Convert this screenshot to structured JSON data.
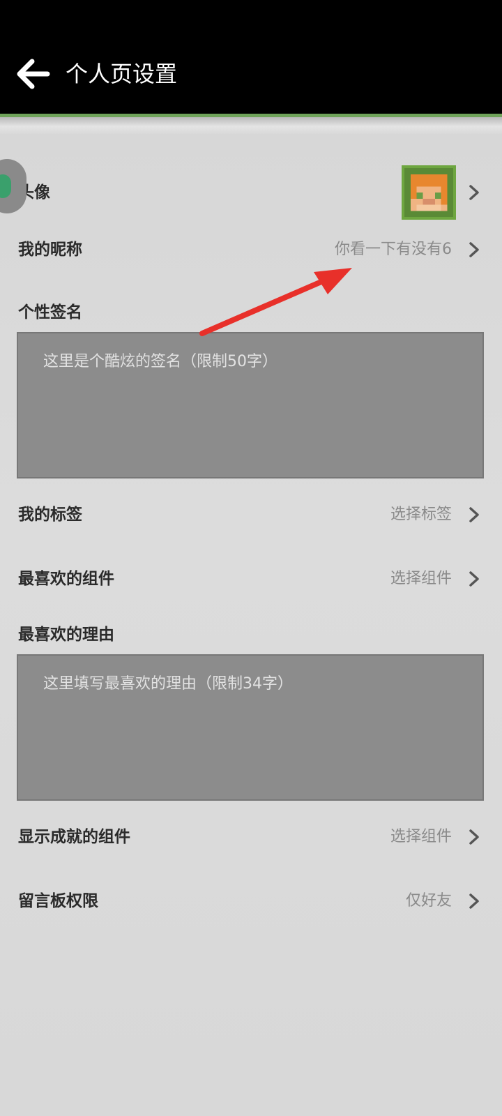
{
  "header": {
    "title": "个人页设置",
    "back_icon": "back-arrow-icon"
  },
  "rows": {
    "avatar": {
      "label": "头像"
    },
    "nickname": {
      "label": "我的昵称",
      "value": "你看一下有没有6"
    },
    "signature": {
      "label": "个性签名",
      "placeholder": "这里是个酷炫的签名（限制50字）"
    },
    "tags": {
      "label": "我的标签",
      "value": "选择标签"
    },
    "favorite_component": {
      "label": "最喜欢的组件",
      "value": "选择组件"
    },
    "favorite_reason": {
      "label": "最喜欢的理由",
      "placeholder": "这里填写最喜欢的理由（限制34字）"
    },
    "achievement_component": {
      "label": "显示成就的组件",
      "value": "选择组件"
    },
    "message_board": {
      "label": "留言板权限",
      "value": "仅好友"
    }
  },
  "colors": {
    "header_bg": "#000000",
    "accent_green": "#6fa35a",
    "page_bg": "#d9d9d9",
    "textarea_bg": "#8c8c8c",
    "annotation_red": "#e8302a"
  }
}
